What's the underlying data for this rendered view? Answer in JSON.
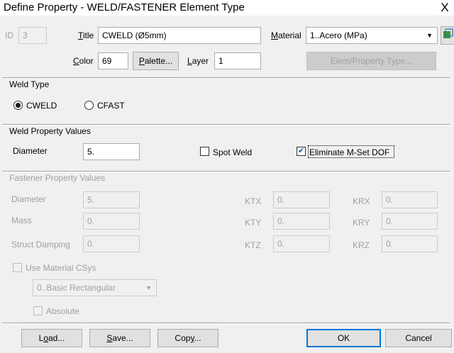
{
  "window": {
    "title": "Define Property - WELD/FASTENER Element Type",
    "close_glyph": "X"
  },
  "top": {
    "id_label": "ID",
    "id_value": "3",
    "title_label": "Title",
    "title_value": "CWELD (Ø5mm)",
    "material_label": "Material",
    "material_value": "1..Acero (MPa)",
    "color_label": "Color",
    "color_value": "69",
    "palette_button": "Palette...",
    "layer_label": "Layer",
    "layer_value": "1",
    "elem_property_button": "Elem/Property Type..."
  },
  "weld_type": {
    "heading": "Weld Type",
    "options": [
      {
        "label": "CWELD",
        "selected": true
      },
      {
        "label": "CFAST",
        "selected": false
      }
    ]
  },
  "weld_property": {
    "heading": "Weld Property Values",
    "diameter_label": "Diameter",
    "diameter_value": "5.",
    "spot_weld_label": "Spot Weld",
    "spot_weld_checked": false,
    "eliminate_label": "Eliminate M-Set DOF",
    "eliminate_checked": true
  },
  "fastener": {
    "heading": "Fastener Property Values",
    "rows": [
      {
        "label": "Diameter",
        "value": "5."
      },
      {
        "label": "Mass",
        "value": "0."
      },
      {
        "label": "Struct Damping",
        "value": "0."
      }
    ],
    "k_rows": [
      {
        "kt_label": "KTX",
        "kt_value": "0.",
        "kr_label": "KRX",
        "kr_value": "0."
      },
      {
        "kt_label": "KTY",
        "kt_value": "0.",
        "kr_label": "KRY",
        "kr_value": "0."
      },
      {
        "kt_label": "KTZ",
        "kt_value": "0.",
        "kr_label": "KRZ",
        "kr_value": "0."
      }
    ],
    "use_material_csys_label": "Use Material CSys",
    "csys_value": "0..Basic Rectangular",
    "absolute_label": "Absolute"
  },
  "footer": {
    "load": "Load...",
    "save": "Save...",
    "copy": "Copy...",
    "ok": "OK",
    "cancel": "Cancel"
  },
  "colors": {
    "focus_blue": "#0078d7",
    "disabled_text": "#a0a0a0",
    "check_blue": "#1c4f9c"
  },
  "icons": [
    "close-icon",
    "dropdown-arrow-icon",
    "material-browse-icon",
    "checkmark-icon"
  ]
}
